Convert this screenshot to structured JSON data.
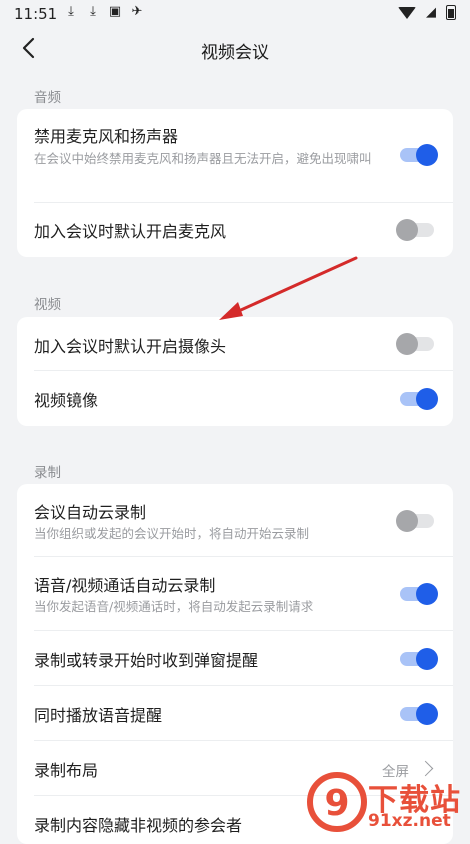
{
  "status": {
    "time": "11:51"
  },
  "header": {
    "title": "视频会议"
  },
  "sections": {
    "audio": {
      "label": "音频",
      "rows": [
        {
          "title": "禁用麦克风和扬声器",
          "desc": "在会议中始终禁用麦克风和扬声器且无法开启，避免出现啸叫",
          "on": true
        },
        {
          "title": "加入会议时默认开启麦克风",
          "on": false
        }
      ]
    },
    "video": {
      "label": "视频",
      "rows": [
        {
          "title": "加入会议时默认开启摄像头",
          "on": false
        },
        {
          "title": "视频镜像",
          "on": true
        }
      ]
    },
    "record": {
      "label": "录制",
      "rows": [
        {
          "title": "会议自动云录制",
          "desc": "当你组织或发起的会议开始时，将自动开始云录制",
          "on": false
        },
        {
          "title": "语音/视频通话自动云录制",
          "desc": "当你发起语音/视频通话时，将自动发起云录制请求",
          "on": true
        },
        {
          "title": "录制或转录开始时收到弹窗提醒",
          "on": true
        },
        {
          "title": "同时播放语音提醒",
          "on": true
        },
        {
          "title": "录制布局",
          "value": "全屏"
        },
        {
          "title": "录制内容隐藏非视频的参会者"
        }
      ]
    }
  },
  "watermark": {
    "text": "下载站",
    "url": "91xz.net",
    "logo_text": "9"
  },
  "colors": {
    "accent": "#1f5ee8",
    "annotation": "#d42a2a",
    "watermark": "#e8503a"
  }
}
